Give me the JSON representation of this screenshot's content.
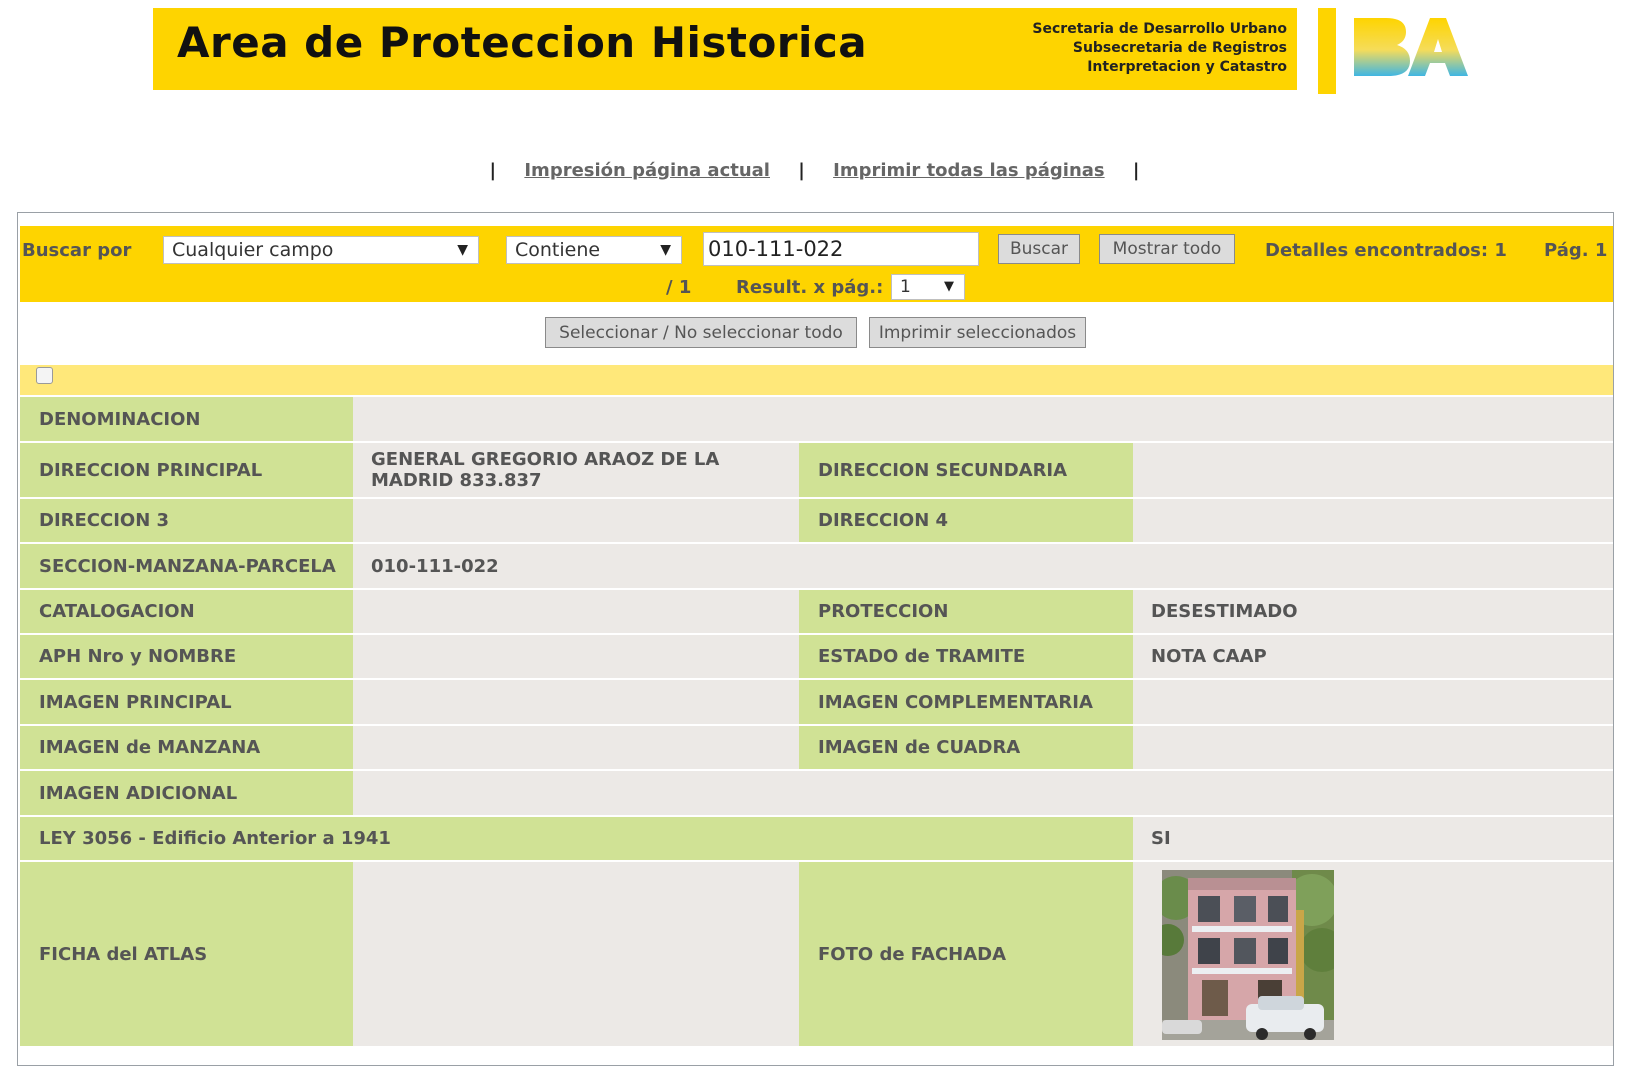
{
  "header": {
    "title": "Area de Proteccion Historica",
    "org_line1": "Secretaria de Desarrollo Urbano",
    "org_line2": "Subsecretaria de Registros",
    "org_line3": "Interpretacion y Catastro",
    "logo_icon": "ba-logo-icon",
    "brand_color": "#fed400"
  },
  "print_links": {
    "separator": "|",
    "current_page": "Impresión página actual",
    "all_pages": "Imprimir todas las páginas"
  },
  "search": {
    "label": "Buscar por",
    "field_select": "Cualquier campo",
    "operator_select": "Contiene",
    "query_value": "010-111-022",
    "search_button": "Buscar",
    "show_all_button": "Mostrar todo",
    "results_found": "Detalles encontrados: 1",
    "page_label": "Pág. 1",
    "page_total": "/ 1",
    "per_page_label": "Result. x pág.:",
    "per_page_select": "1"
  },
  "actions": {
    "select_toggle_button": "Seleccionar / No seleccionar todo",
    "print_selected_button": "Imprimir seleccionados"
  },
  "record": {
    "denominacion_label": "DENOMINACION",
    "denominacion_value": "",
    "dir_principal_label": "DIRECCION PRINCIPAL",
    "dir_principal_value": "GENERAL GREGORIO ARAOZ DE LA MADRID 833.837",
    "dir_secundaria_label": "DIRECCION SECUNDARIA",
    "dir_secundaria_value": "",
    "dir3_label": "DIRECCION 3",
    "dir3_value": "",
    "dir4_label": "DIRECCION 4",
    "dir4_value": "",
    "smp_label": "SECCION-MANZANA-PARCELA",
    "smp_value": "010-111-022",
    "catalogacion_label": "CATALOGACION",
    "catalogacion_value": "",
    "proteccion_label": "PROTECCION",
    "proteccion_value": "DESESTIMADO",
    "aph_label": "APH Nro y NOMBRE",
    "aph_value": "",
    "estado_label": "ESTADO de TRAMITE",
    "estado_value": "NOTA CAAP",
    "img_principal_label": "IMAGEN PRINCIPAL",
    "img_principal_value": "",
    "img_complementaria_label": "IMAGEN COMPLEMENTARIA",
    "img_complementaria_value": "",
    "img_manzana_label": "IMAGEN de MANZANA",
    "img_manzana_value": "",
    "img_cuadra_label": "IMAGEN de CUADRA",
    "img_cuadra_value": "",
    "img_adicional_label": "IMAGEN ADICIONAL",
    "img_adicional_value": "",
    "ley_label": "LEY 3056 - Edificio Anterior a 1941",
    "ley_value": "SI",
    "ficha_label": "FICHA del ATLAS",
    "ficha_value": "",
    "foto_label": "FOTO de FACHADA",
    "foto_icon": "facade-photo"
  },
  "colors": {
    "label_cell": "#d0e295",
    "value_cell": "#ece9e6",
    "select_row": "#ffe87a"
  }
}
